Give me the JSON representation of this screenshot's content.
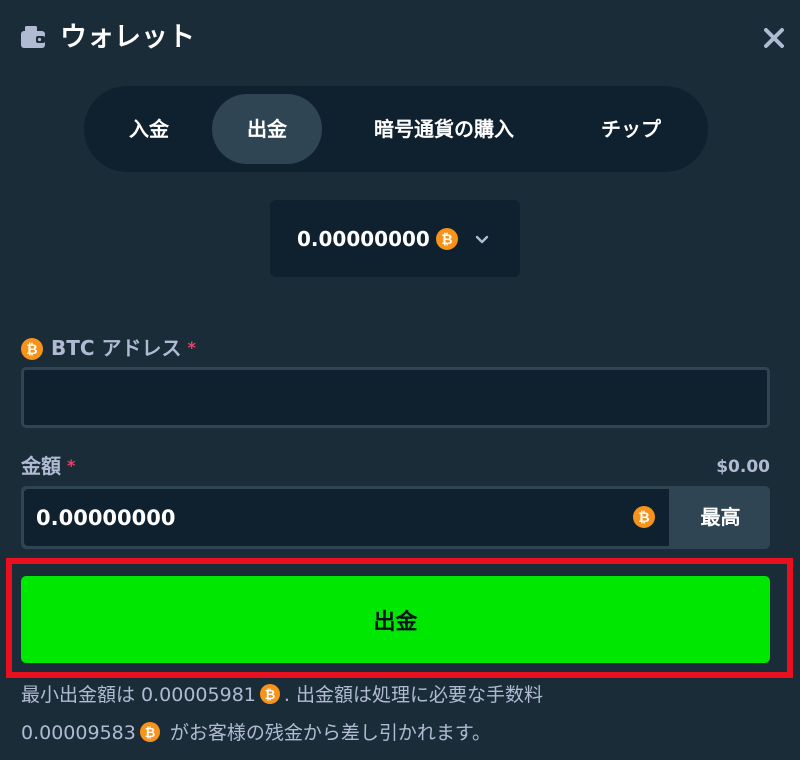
{
  "header": {
    "title": "ウォレット"
  },
  "tabs": [
    {
      "label": "入金",
      "active": false
    },
    {
      "label": "出金",
      "active": true
    },
    {
      "label": "暗号通貨の購入",
      "active": false
    },
    {
      "label": "チップ",
      "active": false
    }
  ],
  "balance": {
    "value": "0.00000000",
    "currency_icon": "bitcoin-icon"
  },
  "address": {
    "label": "BTC アドレス",
    "required": "*",
    "value": ""
  },
  "amount": {
    "label": "金額",
    "required": "*",
    "usd": "$0.00",
    "value": "0.00000000",
    "max_label": "最高"
  },
  "submit": {
    "label": "出金"
  },
  "notice": {
    "line1_a": "最小出金額は 0.00005981",
    "line1_b": ". 出金額は処理に必要な手数料",
    "line2_a": "0.00009583",
    "line2_b": " がお客様の残金から差し引かれます。"
  },
  "colors": {
    "background": "#1a2c38",
    "panel": "#0f212e",
    "active_tab": "#2f4553",
    "submit_green": "#00e701",
    "highlight_red": "#e8101f",
    "bitcoin_orange": "#f7931a"
  }
}
